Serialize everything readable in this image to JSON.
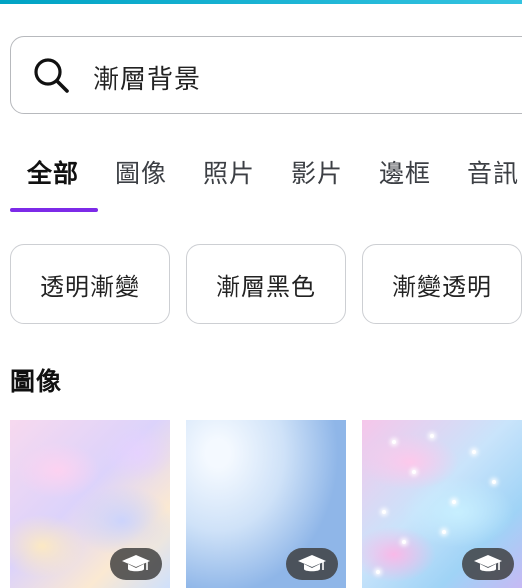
{
  "search": {
    "value": "漸層背景",
    "icon": "search-icon"
  },
  "tabs": [
    {
      "label": "全部",
      "active": true
    },
    {
      "label": "圖像",
      "active": false
    },
    {
      "label": "照片",
      "active": false
    },
    {
      "label": "影片",
      "active": false
    },
    {
      "label": "邊框",
      "active": false
    },
    {
      "label": "音訊",
      "active": false
    }
  ],
  "suggestions": [
    {
      "label": "透明漸變"
    },
    {
      "label": "漸層黑色"
    },
    {
      "label": "漸變透明"
    }
  ],
  "section": {
    "title": "圖像"
  },
  "results": [
    {
      "description": "pastel watercolor clouds",
      "badge_icon": "graduation-cap-icon"
    },
    {
      "description": "light blue gradient",
      "badge_icon": "graduation-cap-icon"
    },
    {
      "description": "pastel sparkle sky",
      "badge_icon": "graduation-cap-icon"
    }
  ],
  "colors": {
    "accent": "#7d2ae8",
    "top_bar": "#1fb6d6"
  }
}
